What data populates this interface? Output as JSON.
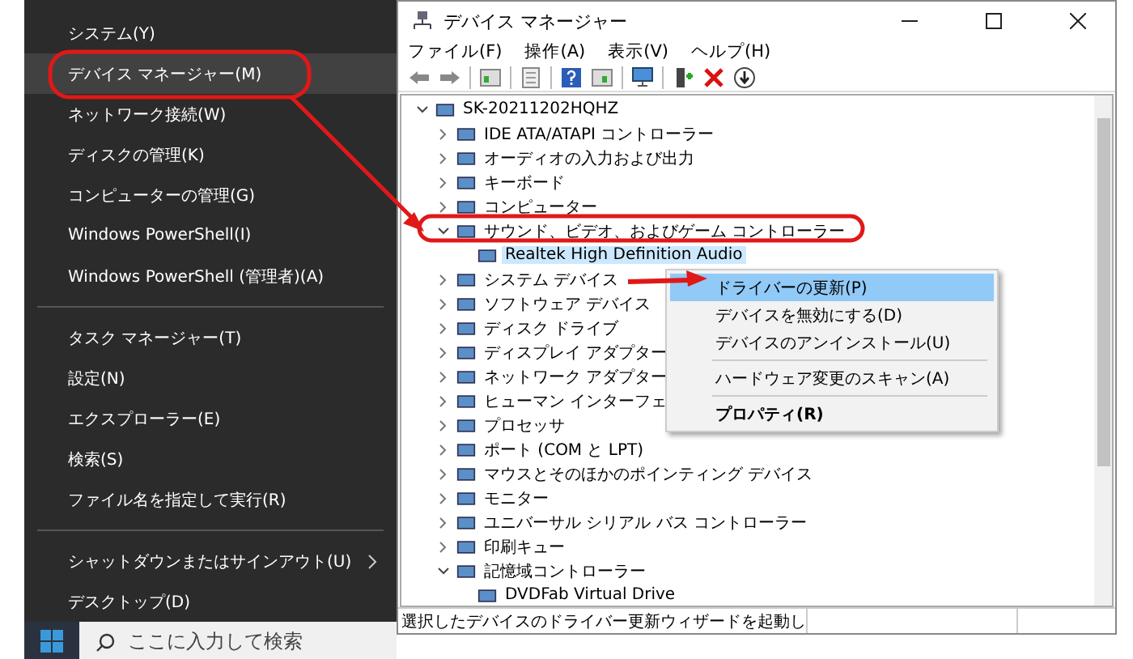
{
  "start_menu": {
    "groups": [
      [
        {
          "label": "システム(Y)",
          "selected": false,
          "submenu": false
        },
        {
          "label": "デバイス マネージャー(M)",
          "selected": true,
          "submenu": false
        },
        {
          "label": "ネットワーク接続(W)",
          "selected": false,
          "submenu": false
        },
        {
          "label": "ディスクの管理(K)",
          "selected": false,
          "submenu": false
        },
        {
          "label": "コンピューターの管理(G)",
          "selected": false,
          "submenu": false
        },
        {
          "label": "Windows PowerShell(I)",
          "selected": false,
          "submenu": false
        },
        {
          "label": "Windows PowerShell (管理者)(A)",
          "selected": false,
          "submenu": false
        }
      ],
      [
        {
          "label": "タスク マネージャー(T)",
          "selected": false,
          "submenu": false
        },
        {
          "label": "設定(N)",
          "selected": false,
          "submenu": false
        },
        {
          "label": "エクスプローラー(E)",
          "selected": false,
          "submenu": false
        },
        {
          "label": "検索(S)",
          "selected": false,
          "submenu": false
        },
        {
          "label": "ファイル名を指定して実行(R)",
          "selected": false,
          "submenu": false
        }
      ],
      [
        {
          "label": "シャットダウンまたはサインアウト(U)",
          "selected": false,
          "submenu": true
        },
        {
          "label": "デスクトップ(D)",
          "selected": false,
          "submenu": false
        }
      ]
    ]
  },
  "taskbar": {
    "search": {
      "placeholder": "ここに入力して検索"
    }
  },
  "window": {
    "title": "デバイス マネージャー",
    "menu": [
      "ファイル(F)",
      "操作(A)",
      "表示(V)",
      "ヘルプ(H)"
    ],
    "tree": {
      "label": "SK-20211202HQHZ",
      "expanded": true,
      "selected": false,
      "children": [
        {
          "label": "IDE ATA/ATAPI コントローラー",
          "expanded": false,
          "selected": false
        },
        {
          "label": "オーディオの入力および出力",
          "expanded": false,
          "selected": false
        },
        {
          "label": "キーボード",
          "expanded": false,
          "selected": false
        },
        {
          "label": "コンピューター",
          "expanded": false,
          "selected": false
        },
        {
          "label": "サウンド、ビデオ、およびゲーム コントローラー",
          "expanded": true,
          "selected": false,
          "children": [
            {
              "label": "Realtek High Definition Audio",
              "selected": true
            }
          ]
        },
        {
          "label": "システム デバイス",
          "expanded": false,
          "selected": false
        },
        {
          "label": "ソフトウェア デバイス",
          "expanded": false,
          "selected": false
        },
        {
          "label": "ディスク ドライブ",
          "expanded": false,
          "selected": false
        },
        {
          "label": "ディスプレイ アダプター",
          "expanded": false,
          "selected": false
        },
        {
          "label": "ネットワーク アダプター",
          "expanded": false,
          "selected": false
        },
        {
          "label": "ヒューマン インターフェ",
          "expanded": false,
          "selected": false
        },
        {
          "label": "プロセッサ",
          "expanded": false,
          "selected": false
        },
        {
          "label": "ポート (COM と LPT)",
          "expanded": false,
          "selected": false
        },
        {
          "label": "マウスとそのほかのポインティング デバイス",
          "expanded": false,
          "selected": false
        },
        {
          "label": "モニター",
          "expanded": false,
          "selected": false
        },
        {
          "label": "ユニバーサル シリアル バス コントローラー",
          "expanded": false,
          "selected": false
        },
        {
          "label": "印刷キュー",
          "expanded": false,
          "selected": false
        },
        {
          "label": "記憶域コントローラー",
          "expanded": true,
          "selected": false,
          "children": [
            {
              "label": "DVDFab Virtual Drive",
              "selected": false
            }
          ]
        }
      ]
    },
    "context_menu": {
      "groups": [
        [
          {
            "label": "ドライバーの更新(P)",
            "selected": true,
            "default": false
          },
          {
            "label": "デバイスを無効にする(D)",
            "selected": false,
            "default": false
          },
          {
            "label": "デバイスのアンインストール(U)",
            "selected": false,
            "default": false
          }
        ],
        [
          {
            "label": "ハードウェア変更のスキャン(A)",
            "selected": false,
            "default": false
          }
        ],
        [
          {
            "label": "プロパティ(R)",
            "selected": false,
            "default": true
          }
        ]
      ]
    },
    "status_bar": {
      "text": "選択したデバイスのドライバー更新ウィザードを起動し"
    }
  }
}
